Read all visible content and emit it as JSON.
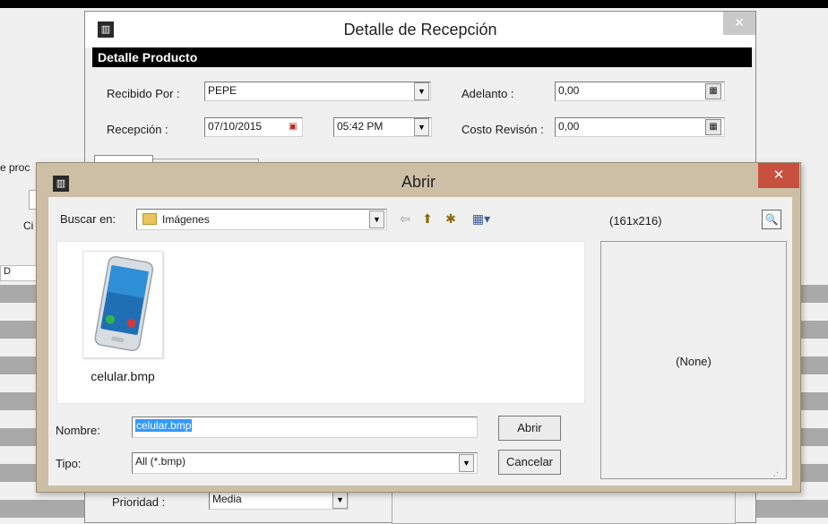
{
  "background": {
    "left_label_1": "e proc",
    "left_label_2": "Ci",
    "column_header": "D"
  },
  "detalle": {
    "title": "Detalle de Recepción",
    "close_symbol": "✕",
    "section_header": "Detalle Producto",
    "recibido_label": "Recibido Por :",
    "recibido_value": "PEPE",
    "recepcion_label": "Recepción :",
    "recepcion_date": "07/10/2015",
    "recepcion_time": "05:42 PM",
    "adelanto_label": "Adelanto :",
    "adelanto_value": "0,00",
    "costo_label": "Costo Revisón :",
    "costo_value": "0,00",
    "prioridad_label": "Prioridad :",
    "prioridad_value": "Media"
  },
  "abrir": {
    "title": "Abrir",
    "close_symbol": "✕",
    "lookin_label": "Buscar en:",
    "lookin_value": "Imágenes",
    "preview_size": "(161x216)",
    "preview_none": "(None)",
    "file_name": "celular.bmp",
    "nombre_label": "Nombre:",
    "nombre_value": "celular.bmp",
    "tipo_label": "Tipo:",
    "tipo_value": "All (*.bmp)",
    "open_button": "Abrir",
    "cancel_button": "Cancelar"
  },
  "icons": {
    "dropdown": "▼",
    "back": "⇦",
    "up_folder": "⬆",
    "new_folder": "✱",
    "view_menu": "▦▾",
    "preview_toggle": "🔍",
    "calculator": "▦",
    "calendar": "▣",
    "resize": "⋰"
  }
}
